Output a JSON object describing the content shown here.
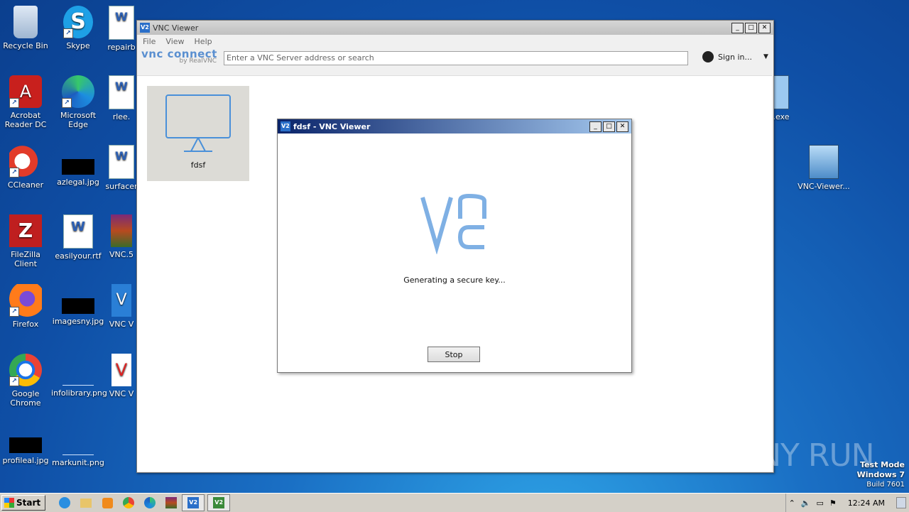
{
  "desktop": {
    "icons": [
      {
        "label": "Recycle Bin"
      },
      {
        "label": "Skype"
      },
      {
        "label": "repairb"
      },
      {
        "label": "Acrobat Reader DC"
      },
      {
        "label": "Microsoft Edge"
      },
      {
        "label": "rlee."
      },
      {
        "label": "CCleaner"
      },
      {
        "label": "azlegal.jpg"
      },
      {
        "label": "surfacer"
      },
      {
        "label": "FileZilla Client"
      },
      {
        "label": "easilyour.rtf"
      },
      {
        "label": "VNC.5"
      },
      {
        "label": "Firefox"
      },
      {
        "label": "imagesny.jpg"
      },
      {
        "label": "VNC V"
      },
      {
        "label": "Google Chrome"
      },
      {
        "label": "infolibrary.png"
      },
      {
        "label": "VNC V"
      },
      {
        "label": "profileal.jpg"
      },
      {
        "label": "markunit.png"
      },
      {
        "label": ".exe"
      },
      {
        "label": "VNC-Viewer..."
      }
    ]
  },
  "main_window": {
    "title": "VNC Viewer",
    "menu": [
      "File",
      "View",
      "Help"
    ],
    "logo_top": "vnc connect",
    "logo_bottom": "by RealVNC",
    "address_placeholder": "Enter a VNC Server address or search",
    "sign_in": "Sign in...",
    "tile_label": "fdsf"
  },
  "dialog": {
    "title": "fdsf - VNC Viewer",
    "status": "Generating a secure key...",
    "stop_label": "Stop"
  },
  "watermark": {
    "text": "ANY RUN"
  },
  "os_info": {
    "line1": "Test Mode",
    "line2": "Windows 7",
    "line3": "Build 7601"
  },
  "taskbar": {
    "start_label": "Start",
    "clock": "12:24 AM"
  }
}
